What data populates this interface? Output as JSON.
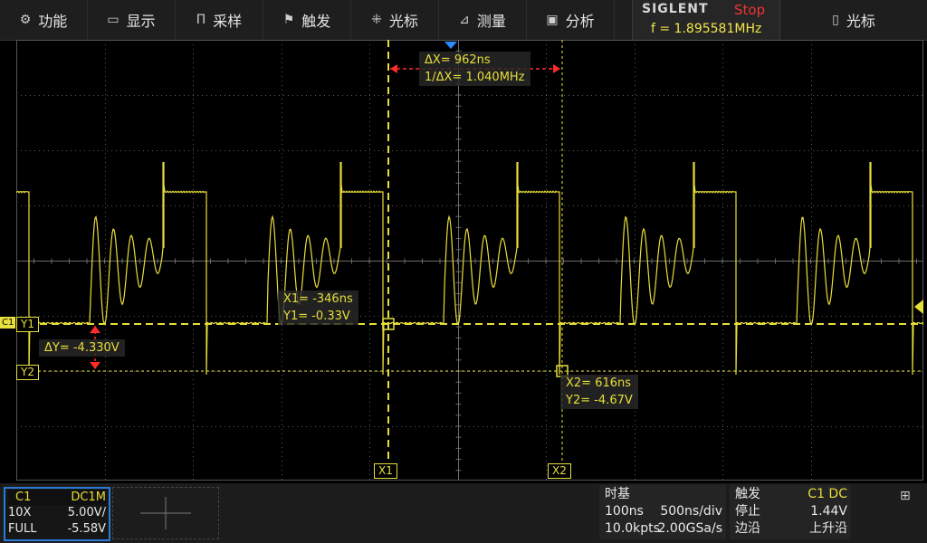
{
  "menu": [
    {
      "icon": "⚙",
      "label": "功能",
      "name": "function"
    },
    {
      "icon": "▭",
      "label": "显示",
      "name": "display"
    },
    {
      "icon": "Π",
      "label": "采样",
      "name": "acquire"
    },
    {
      "icon": "⚑",
      "label": "触发",
      "name": "trigger"
    },
    {
      "icon": "⁜",
      "label": "光标",
      "name": "cursor"
    },
    {
      "icon": "⊿",
      "label": "测量",
      "name": "measure"
    },
    {
      "icon": "▣",
      "label": "分析",
      "name": "analysis"
    }
  ],
  "brand": {
    "name": "SIGLENT",
    "state": "Stop",
    "frequency": "f = 1.895581MHz"
  },
  "softkey": {
    "icon": "▯",
    "label": "光标"
  },
  "cursors": {
    "delta_x": "ΔX= 962ns",
    "inv_delta_x": "1/ΔX= 1.040MHz",
    "x1": "X1= -346ns",
    "y1": "Y1= -0.33V",
    "delta_y": "ΔY= -4.330V",
    "x2": "X2= 616ns",
    "y2": "Y2= -4.67V",
    "tag_x1": "X1",
    "tag_x2": "X2",
    "tag_y1": "Y1",
    "tag_y2": "Y2",
    "channel_marker": "C1"
  },
  "channel1": {
    "label": "C1",
    "coupling": "DC1M",
    "probe": "10X",
    "scale": "5.00V/",
    "bandwidth": "FULL",
    "offset": "-5.58V"
  },
  "timebase": {
    "title": "时基",
    "delay": "100ns",
    "scale": "500ns/div",
    "memory": "10.0kpts",
    "sample_rate": "2.00GSa/s"
  },
  "trigger": {
    "title": "触发",
    "source": "C1 DC",
    "state": "停止",
    "level": "1.44V",
    "type": "边沿",
    "slope": "上升沿"
  },
  "colors": {
    "trace": "#e8df3a",
    "cursor": "#e8df3a",
    "accent": "#2a7bd6",
    "stop": "#ee3333",
    "arrow": "#ff2a2a"
  }
}
